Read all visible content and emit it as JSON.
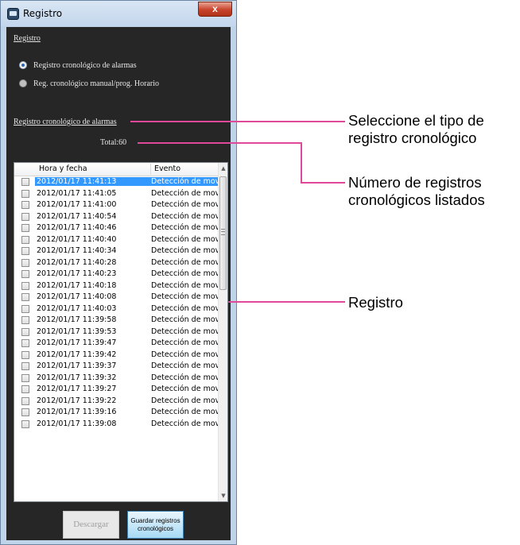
{
  "window": {
    "title": "Registro",
    "close_label": "x"
  },
  "panel": {
    "section_title": "Registro",
    "radio_options": [
      {
        "label": "Registro cronológico de alarmas",
        "selected": true
      },
      {
        "label": "Reg. cronológico manual/prog. Horario",
        "selected": false
      }
    ],
    "list_title": "Registro cronológico de alarmas",
    "total_label": "Total:60"
  },
  "table": {
    "columns": [
      "Hora y fecha",
      "Evento"
    ],
    "selected_row": 0,
    "rows": [
      {
        "datetime": "2012/01/17 11:41:13",
        "event": "Detección de movir"
      },
      {
        "datetime": "2012/01/17 11:41:05",
        "event": "Detección de movir"
      },
      {
        "datetime": "2012/01/17 11:41:00",
        "event": "Detección de movir"
      },
      {
        "datetime": "2012/01/17 11:40:54",
        "event": "Detección de movir"
      },
      {
        "datetime": "2012/01/17 11:40:46",
        "event": "Detección de movir"
      },
      {
        "datetime": "2012/01/17 11:40:40",
        "event": "Detección de movir"
      },
      {
        "datetime": "2012/01/17 11:40:34",
        "event": "Detección de movir"
      },
      {
        "datetime": "2012/01/17 11:40:28",
        "event": "Detección de movir"
      },
      {
        "datetime": "2012/01/17 11:40:23",
        "event": "Detección de movir"
      },
      {
        "datetime": "2012/01/17 11:40:18",
        "event": "Detección de movir"
      },
      {
        "datetime": "2012/01/17 11:40:08",
        "event": "Detección de movir"
      },
      {
        "datetime": "2012/01/17 11:40:03",
        "event": "Detección de movir"
      },
      {
        "datetime": "2012/01/17 11:39:58",
        "event": "Detección de movir"
      },
      {
        "datetime": "2012/01/17 11:39:53",
        "event": "Detección de movir"
      },
      {
        "datetime": "2012/01/17 11:39:47",
        "event": "Detección de movir"
      },
      {
        "datetime": "2012/01/17 11:39:42",
        "event": "Detección de movir"
      },
      {
        "datetime": "2012/01/17 11:39:37",
        "event": "Detección de movir"
      },
      {
        "datetime": "2012/01/17 11:39:32",
        "event": "Detección de movir"
      },
      {
        "datetime": "2012/01/17 11:39:27",
        "event": "Detección de movir"
      },
      {
        "datetime": "2012/01/17 11:39:22",
        "event": "Detección de movir"
      },
      {
        "datetime": "2012/01/17 11:39:16",
        "event": "Detección de movir"
      },
      {
        "datetime": "2012/01/17 11:39:08",
        "event": "Detección de movir"
      }
    ]
  },
  "buttons": {
    "download": "Descargar",
    "save_line1": "Guardar registros",
    "save_line2": "cronológicos"
  },
  "annotations": {
    "type_line1": "Seleccione el tipo de",
    "type_line2": "registro cronológico",
    "count_line1": "Número de registros",
    "count_line2": "cronológicos listados",
    "log": "Registro"
  },
  "colors": {
    "callout": "#e0489a",
    "selection": "#3399ff",
    "panel_bg": "#262626"
  },
  "icons": {
    "app": "window-app-icon",
    "close": "close-icon",
    "scroll_up": "scroll-up-arrow-icon",
    "scroll_down": "scroll-down-arrow-icon"
  }
}
